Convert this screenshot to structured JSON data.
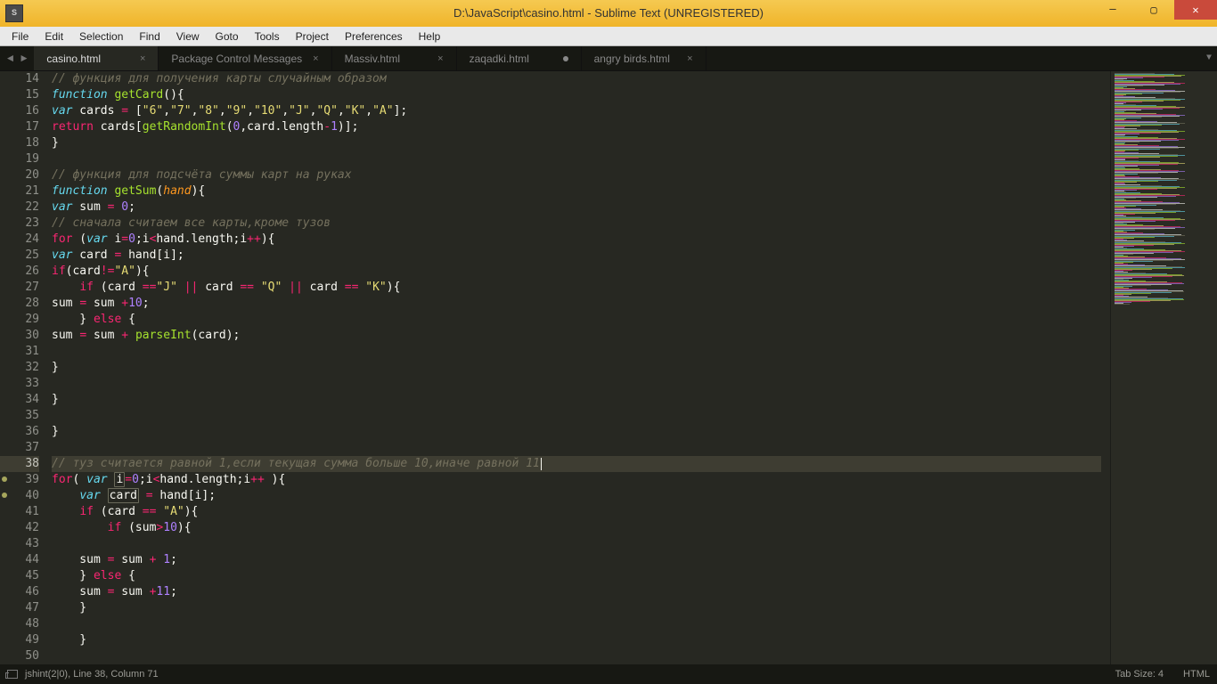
{
  "window": {
    "title": "D:\\JavaScript\\casino.html - Sublime Text (UNREGISTERED)",
    "app_icon_letter": "S"
  },
  "menu": [
    "File",
    "Edit",
    "Selection",
    "Find",
    "View",
    "Goto",
    "Tools",
    "Project",
    "Preferences",
    "Help"
  ],
  "tabs": [
    {
      "label": "casino.html",
      "active": true,
      "dirty": false
    },
    {
      "label": "Package Control Messages",
      "active": false,
      "dirty": false
    },
    {
      "label": "Massiv.html",
      "active": false,
      "dirty": false
    },
    {
      "label": "zaqadki.html",
      "active": false,
      "dirty": true
    },
    {
      "label": "angry birds.html",
      "active": false,
      "dirty": false
    }
  ],
  "editor": {
    "first_line": 14,
    "highlight_line": 38,
    "modified_lines": [
      39,
      40
    ],
    "lines": [
      {
        "n": 14,
        "t": [
          [
            "c-comment",
            "// функция для получения карты случайным образом"
          ]
        ]
      },
      {
        "n": 15,
        "t": [
          [
            "c-storage",
            "function"
          ],
          [
            "",
            " "
          ],
          [
            "c-fn",
            "getCard"
          ],
          [
            "",
            "(){"
          ]
        ]
      },
      {
        "n": 16,
        "t": [
          [
            "c-storage",
            "var"
          ],
          [
            "",
            " cards "
          ],
          [
            "c-kw",
            "="
          ],
          [
            "",
            " ["
          ],
          [
            "c-str",
            "\"6\""
          ],
          [
            "",
            ","
          ],
          [
            "c-str",
            "\"7\""
          ],
          [
            "",
            ","
          ],
          [
            "c-str",
            "\"8\""
          ],
          [
            "",
            ","
          ],
          [
            "c-str",
            "\"9\""
          ],
          [
            "",
            ","
          ],
          [
            "c-str",
            "\"10\""
          ],
          [
            "",
            ","
          ],
          [
            "c-str",
            "\"J\""
          ],
          [
            "",
            ","
          ],
          [
            "c-str",
            "\"Q\""
          ],
          [
            "",
            ","
          ],
          [
            "c-str",
            "\"K\""
          ],
          [
            "",
            ","
          ],
          [
            "c-str",
            "\"A\""
          ],
          [
            "",
            "];"
          ]
        ]
      },
      {
        "n": 17,
        "t": [
          [
            "c-kw",
            "return"
          ],
          [
            "",
            " cards["
          ],
          [
            "c-fn",
            "getRandomInt"
          ],
          [
            "",
            "("
          ],
          [
            "c-num",
            "0"
          ],
          [
            "",
            ",card.length"
          ],
          [
            "c-kw",
            "-"
          ],
          [
            "c-num",
            "1"
          ],
          [
            "",
            ")];"
          ]
        ]
      },
      {
        "n": 18,
        "t": [
          [
            "",
            "}"
          ]
        ]
      },
      {
        "n": 19,
        "t": [
          [
            "",
            ""
          ]
        ]
      },
      {
        "n": 20,
        "t": [
          [
            "c-comment",
            "// функция для подсчёта суммы карт на руках"
          ]
        ]
      },
      {
        "n": 21,
        "t": [
          [
            "c-storage",
            "function"
          ],
          [
            "",
            " "
          ],
          [
            "c-fn",
            "getSum"
          ],
          [
            "",
            "("
          ],
          [
            "c-param",
            "hand"
          ],
          [
            "",
            "){"
          ]
        ]
      },
      {
        "n": 22,
        "t": [
          [
            "c-storage",
            "var"
          ],
          [
            "",
            " sum "
          ],
          [
            "c-kw",
            "="
          ],
          [
            "",
            " "
          ],
          [
            "c-num",
            "0"
          ],
          [
            "",
            ";"
          ]
        ]
      },
      {
        "n": 23,
        "t": [
          [
            "c-comment",
            "// сначала считаем все карты,кроме тузов"
          ]
        ]
      },
      {
        "n": 24,
        "t": [
          [
            "c-kw",
            "for"
          ],
          [
            "",
            " ("
          ],
          [
            "c-storage",
            "var"
          ],
          [
            "",
            " i"
          ],
          [
            "c-kw",
            "="
          ],
          [
            "c-num",
            "0"
          ],
          [
            "",
            ";i"
          ],
          [
            "c-kw",
            "<"
          ],
          [
            "",
            "hand.length;i"
          ],
          [
            "c-kw",
            "++"
          ],
          [
            "",
            "){"
          ]
        ]
      },
      {
        "n": 25,
        "t": [
          [
            "c-storage",
            "var"
          ],
          [
            "",
            " card "
          ],
          [
            "c-kw",
            "="
          ],
          [
            "",
            " hand[i];"
          ]
        ]
      },
      {
        "n": 26,
        "t": [
          [
            "c-kw",
            "if"
          ],
          [
            "",
            "(card"
          ],
          [
            "c-kw",
            "!="
          ],
          [
            "c-str",
            "\"A\""
          ],
          [
            "",
            "){"
          ]
        ]
      },
      {
        "n": 27,
        "t": [
          [
            "",
            "    "
          ],
          [
            "c-kw",
            "if"
          ],
          [
            "",
            " (card "
          ],
          [
            "c-kw",
            "=="
          ],
          [
            "c-str",
            "\"J\""
          ],
          [
            "",
            " "
          ],
          [
            "c-kw",
            "||"
          ],
          [
            "",
            " card "
          ],
          [
            "c-kw",
            "=="
          ],
          [
            "",
            " "
          ],
          [
            "c-str",
            "\"Q\""
          ],
          [
            "",
            " "
          ],
          [
            "c-kw",
            "||"
          ],
          [
            "",
            " card "
          ],
          [
            "c-kw",
            "=="
          ],
          [
            "",
            " "
          ],
          [
            "c-str",
            "\"K\""
          ],
          [
            "",
            "){"
          ]
        ]
      },
      {
        "n": 28,
        "t": [
          [
            "",
            "sum "
          ],
          [
            "c-kw",
            "="
          ],
          [
            "",
            " sum "
          ],
          [
            "c-kw",
            "+"
          ],
          [
            "c-num",
            "10"
          ],
          [
            "",
            ";"
          ]
        ]
      },
      {
        "n": 29,
        "t": [
          [
            "",
            "    } "
          ],
          [
            "c-kw",
            "else"
          ],
          [
            "",
            " {"
          ]
        ]
      },
      {
        "n": 30,
        "t": [
          [
            "",
            "sum "
          ],
          [
            "c-kw",
            "="
          ],
          [
            "",
            " sum "
          ],
          [
            "c-kw",
            "+"
          ],
          [
            "",
            " "
          ],
          [
            "c-fn",
            "parseInt"
          ],
          [
            "",
            "(card);"
          ]
        ]
      },
      {
        "n": 31,
        "t": [
          [
            "",
            ""
          ]
        ]
      },
      {
        "n": 32,
        "t": [
          [
            "",
            "}"
          ]
        ]
      },
      {
        "n": 33,
        "t": [
          [
            "",
            ""
          ]
        ]
      },
      {
        "n": 34,
        "t": [
          [
            "",
            "}"
          ]
        ]
      },
      {
        "n": 35,
        "t": [
          [
            "",
            ""
          ]
        ]
      },
      {
        "n": 36,
        "t": [
          [
            "",
            "}"
          ]
        ]
      },
      {
        "n": 37,
        "t": [
          [
            "",
            ""
          ]
        ]
      },
      {
        "n": 38,
        "t": [
          [
            "c-comment",
            "// туз считается равной 1,если текущая сумма больше 10,иначе равной 11"
          ]
        ],
        "cursor": true
      },
      {
        "n": 39,
        "t": [
          [
            "c-kw",
            "for"
          ],
          [
            "",
            "( "
          ],
          [
            "c-storage",
            "var"
          ],
          [
            "",
            " "
          ],
          [
            "boxed",
            "i"
          ],
          [
            "c-kw",
            "="
          ],
          [
            "c-num",
            "0"
          ],
          [
            "",
            ";i"
          ],
          [
            "c-kw",
            "<"
          ],
          [
            "",
            "hand.length;i"
          ],
          [
            "c-kw",
            "++"
          ],
          [
            "",
            " ){"
          ]
        ]
      },
      {
        "n": 40,
        "t": [
          [
            "",
            "    "
          ],
          [
            "c-storage",
            "var"
          ],
          [
            "",
            " "
          ],
          [
            "boxed",
            "card"
          ],
          [
            "",
            " "
          ],
          [
            "c-kw",
            "="
          ],
          [
            "",
            " hand[i];"
          ]
        ]
      },
      {
        "n": 41,
        "t": [
          [
            "",
            "    "
          ],
          [
            "c-kw",
            "if"
          ],
          [
            "",
            " (card "
          ],
          [
            "c-kw",
            "=="
          ],
          [
            "",
            " "
          ],
          [
            "c-str",
            "\"A\""
          ],
          [
            "",
            "){"
          ]
        ]
      },
      {
        "n": 42,
        "t": [
          [
            "",
            "        "
          ],
          [
            "c-kw",
            "if"
          ],
          [
            "",
            " (sum"
          ],
          [
            "c-kw",
            ">"
          ],
          [
            "c-num",
            "10"
          ],
          [
            "",
            "){"
          ]
        ]
      },
      {
        "n": 43,
        "t": [
          [
            "",
            ""
          ]
        ]
      },
      {
        "n": 44,
        "t": [
          [
            "",
            "    sum "
          ],
          [
            "c-kw",
            "="
          ],
          [
            "",
            " sum "
          ],
          [
            "c-kw",
            "+"
          ],
          [
            "",
            " "
          ],
          [
            "c-num",
            "1"
          ],
          [
            "",
            ";"
          ]
        ]
      },
      {
        "n": 45,
        "t": [
          [
            "",
            "    } "
          ],
          [
            "c-kw",
            "else"
          ],
          [
            "",
            " {"
          ]
        ]
      },
      {
        "n": 46,
        "t": [
          [
            "",
            "    sum "
          ],
          [
            "c-kw",
            "="
          ],
          [
            "",
            " sum "
          ],
          [
            "c-kw",
            "+"
          ],
          [
            "c-num",
            "11"
          ],
          [
            "",
            ";"
          ]
        ]
      },
      {
        "n": 47,
        "t": [
          [
            "",
            "    }"
          ]
        ]
      },
      {
        "n": 48,
        "t": [
          [
            "",
            ""
          ]
        ]
      },
      {
        "n": 49,
        "t": [
          [
            "",
            "    }"
          ]
        ]
      },
      {
        "n": 50,
        "t": [
          [
            "",
            ""
          ]
        ]
      }
    ]
  },
  "status": {
    "left": "jshint(2|0), Line 38, Column 71",
    "tab_size": "Tab Size: 4",
    "syntax": "HTML"
  }
}
